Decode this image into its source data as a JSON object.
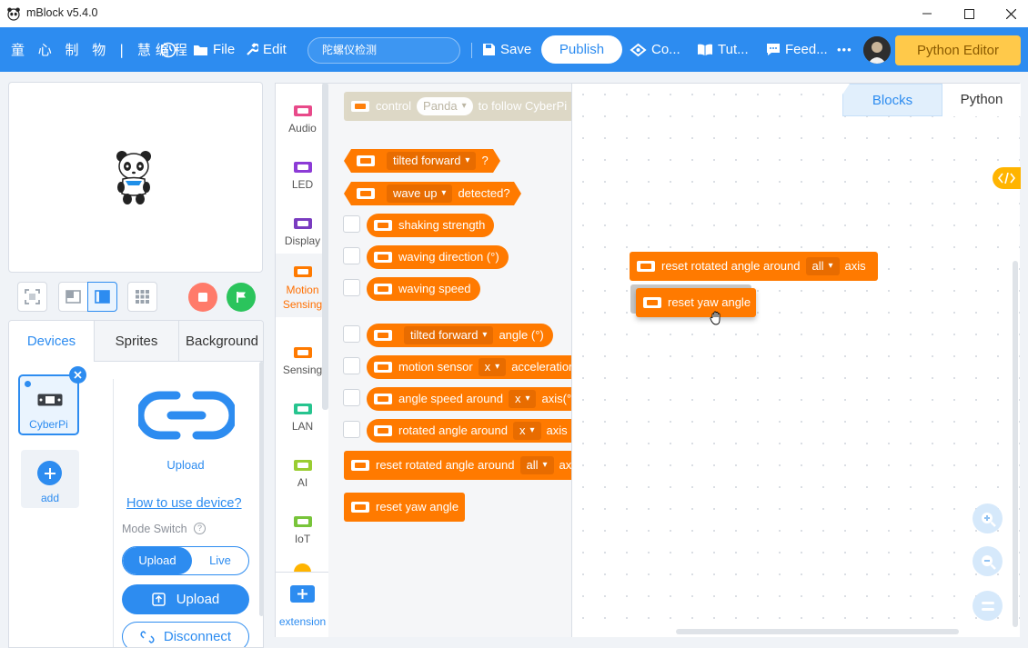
{
  "window": {
    "title": "mBlock v5.4.0"
  },
  "menubar": {
    "brand": "童 心 制 物 | 慧编程",
    "file": "File",
    "edit": "Edit",
    "project_name": "陀螺仪检测",
    "save": "Save",
    "publish": "Publish",
    "courses": "Co...",
    "tutorials": "Tut...",
    "feedback": "Feed...",
    "more": "•••",
    "python_editor": "Python Editor"
  },
  "devices_panel": {
    "tabs": [
      "Devices",
      "Sprites",
      "Background"
    ],
    "device_name": "CyberPi",
    "add_label": "add",
    "upload_icon_label": "Upload",
    "how_to_link": "How to use device?",
    "mode_switch_label": "Mode Switch",
    "mode_upload": "Upload",
    "mode_live": "Live",
    "upload_button": "Upload",
    "disconnect_button": "Disconnect"
  },
  "categories": [
    {
      "label": "Audio",
      "color": "#e84a8a"
    },
    {
      "label": "LED",
      "color": "#8c3bd6"
    },
    {
      "label": "Display",
      "color": "#7a3cc0"
    },
    {
      "label": "Motion Sensing",
      "color": "#ff7a00"
    },
    {
      "label": "Sensing",
      "color": "#ff7a00"
    },
    {
      "label": "LAN",
      "color": "#27c48f"
    },
    {
      "label": "AI",
      "color": "#9acd32"
    },
    {
      "label": "IoT",
      "color": "#78c43a"
    }
  ],
  "extension_label": "extension",
  "palette": {
    "ghost_block": {
      "prefix": "control",
      "dd": "Panda",
      "suffix": "to follow CyberPi"
    },
    "tilted_forward_q": {
      "dd": "tilted forward",
      "suffix": "?"
    },
    "wave_up": {
      "dd": "wave up",
      "suffix": "detected?"
    },
    "shaking_strength": "shaking strength",
    "waving_direction": "waving direction (°)",
    "waving_speed": "waving speed",
    "tilted_angle": {
      "dd": "tilted forward",
      "suffix": "angle (°)"
    },
    "motion_sensor": {
      "prefix": "motion sensor",
      "dd": "x",
      "suffix": "acceleration"
    },
    "angle_speed": {
      "prefix": "angle speed around",
      "dd": "x",
      "suffix": "axis(°/s)"
    },
    "rotated_angle": {
      "prefix": "rotated angle around",
      "dd": "x",
      "suffix": "axis (°)"
    },
    "reset_rotated": {
      "prefix": "reset rotated angle around",
      "dd": "all",
      "suffix": "axis"
    },
    "reset_yaw": "reset yaw angle"
  },
  "workspace": {
    "tabs": [
      "Blocks",
      "Python"
    ],
    "active_tab": "Blocks",
    "block_reset_rotated": {
      "prefix": "reset rotated angle around",
      "dd": "all",
      "suffix": "axis"
    },
    "block_reset_yaw": "reset yaw angle"
  },
  "colors": {
    "accent": "#2d8cf0",
    "motion_block": "#ff7a00",
    "python_editor": "#ffc94a"
  }
}
